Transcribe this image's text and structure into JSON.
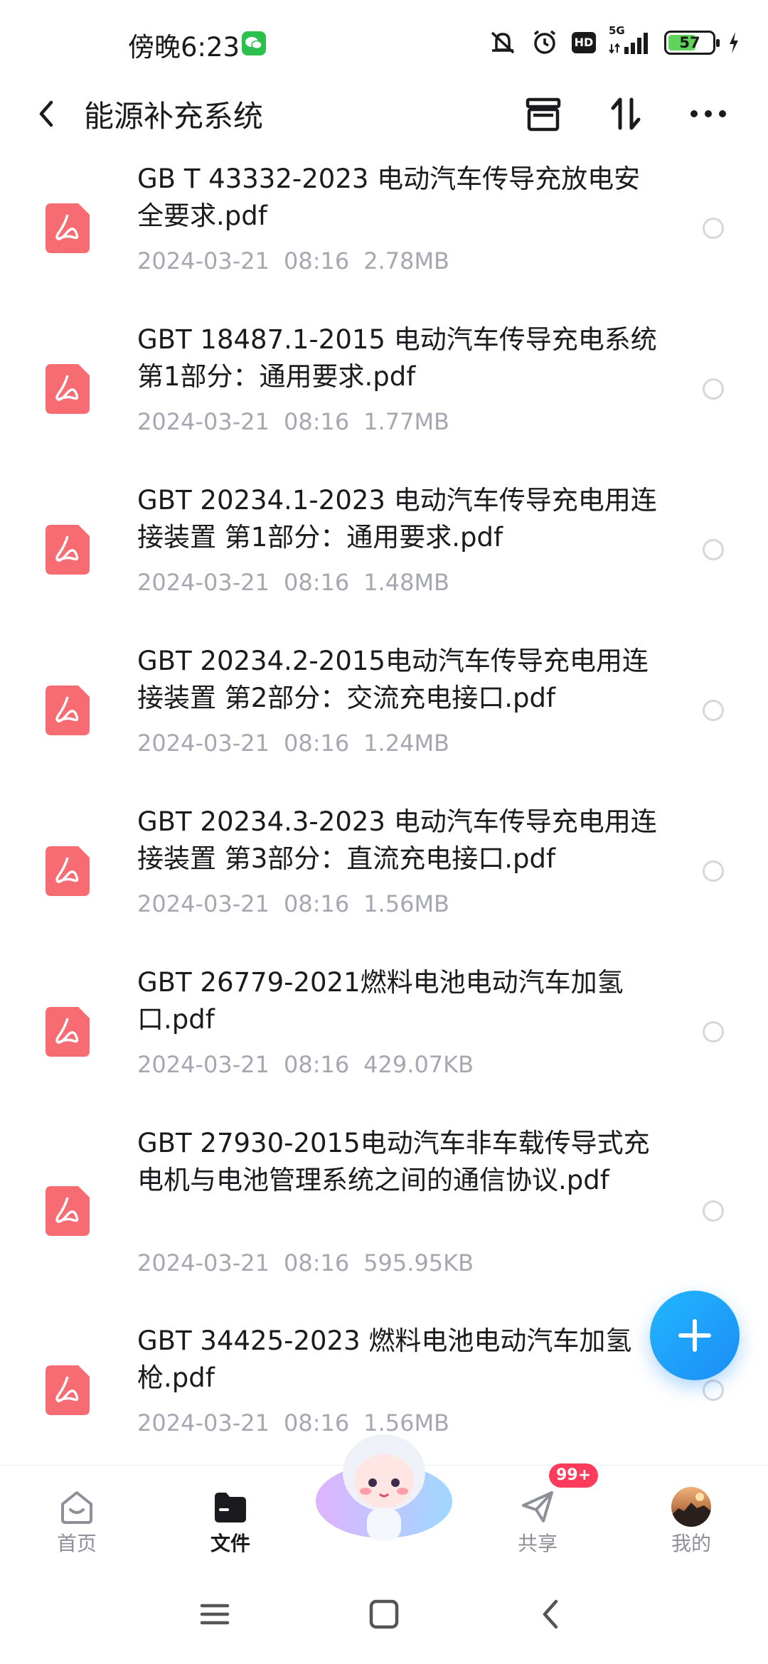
{
  "status_bar": {
    "time": "傍晚6:23",
    "network": "5G",
    "hd": "HD",
    "battery": "57"
  },
  "header": {
    "title": "能源补充系统"
  },
  "files": [
    {
      "name": "GB T 43332-2023 电动汽车传导充放电安全要求.pdf",
      "date": "2024-03-21",
      "time": "08:16",
      "size": "2.78MB"
    },
    {
      "name": "GBT 18487.1-2015 电动汽车传导充电系统 第1部分：通用要求.pdf",
      "date": "2024-03-21",
      "time": "08:16",
      "size": "1.77MB"
    },
    {
      "name": "GBT 20234.1-2023 电动汽车传导充电用连接装置 第1部分：通用要求.pdf",
      "date": "2024-03-21",
      "time": "08:16",
      "size": "1.48MB"
    },
    {
      "name": "GBT 20234.2-2015电动汽车传导充电用连接装置 第2部分：交流充电接口.pdf",
      "date": "2024-03-21",
      "time": "08:16",
      "size": "1.24MB"
    },
    {
      "name": "GBT 20234.3-2023 电动汽车传导充电用连接装置 第3部分：直流充电接口.pdf",
      "date": "2024-03-21",
      "time": "08:16",
      "size": "1.56MB"
    },
    {
      "name": "GBT 26779-2021燃料电池电动汽车加氢口.pdf",
      "date": "2024-03-21",
      "time": "08:16",
      "size": "429.07KB"
    },
    {
      "name": "GBT 27930-2015电动汽车非车载传导式充电机与电池管理系统之间的通信协议.pdf",
      "date": "2024-03-21",
      "time": "08:16",
      "size": "595.95KB"
    },
    {
      "name": "GBT 34425-2023 燃料电池电动汽车加氢枪.pdf",
      "date": "2024-03-21",
      "time": "08:16",
      "size": "1.56MB"
    }
  ],
  "tabs": [
    {
      "label": "首页"
    },
    {
      "label": "文件"
    },
    {
      "label": "共享"
    },
    {
      "label": "我的"
    }
  ],
  "share_badge": "99+",
  "colors": {
    "accent": "#1c8cf5",
    "pdf_icon": "#f76b73",
    "badge": "#ff3b5c",
    "meta_text": "#a5a8b1"
  }
}
